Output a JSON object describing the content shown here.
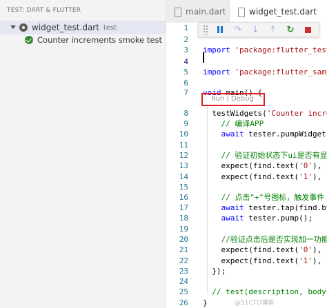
{
  "sidebar": {
    "header": "TEST: DART & FLUTTER",
    "file": {
      "name": "widget_test.dart",
      "desc": "test"
    },
    "test": {
      "name": "Counter increments smoke test"
    }
  },
  "tabs": [
    {
      "label": "main.dart"
    },
    {
      "label": "widget_test.dart"
    }
  ],
  "codelens": "Run | Debug",
  "lines": [
    {
      "n": "1",
      "t": ""
    },
    {
      "n": "2",
      "t": ""
    },
    {
      "n": "3",
      "kw": "import",
      "s": " 'package:flutter_test/"
    },
    {
      "n": "4",
      "t": ""
    },
    {
      "n": "5",
      "kw": "import",
      "s": " 'package:flutter_sampl"
    },
    {
      "n": "6",
      "t": ""
    },
    {
      "n": "7",
      "kw": "void",
      "t": " main() {"
    },
    {
      "n": "8",
      "t": "  testWidgets(",
      "s": "'Counter increm"
    },
    {
      "n": "9",
      "c": "    // 编译APP"
    },
    {
      "n": "10",
      "kw2": "    await",
      "t": " tester.pumpWidget(M"
    },
    {
      "n": "11",
      "t": ""
    },
    {
      "n": "12",
      "c": "    // 验证初始状态下ui是否有显"
    },
    {
      "n": "13",
      "t": "    expect(find.text(",
      "s": "'0'",
      "t2": "), fi"
    },
    {
      "n": "14",
      "t": "    expect(find.text(",
      "s": "'1'",
      "t2": "), fi"
    },
    {
      "n": "15",
      "t": ""
    },
    {
      "n": "16",
      "c": "    // 点击\"+\"号图标，触发事件"
    },
    {
      "n": "17",
      "kw2": "    await",
      "t": " tester.tap(find.byI"
    },
    {
      "n": "18",
      "kw2": "    await",
      "t": " tester.pump();"
    },
    {
      "n": "19",
      "t": ""
    },
    {
      "n": "20",
      "c": "    //验证点击后是否实现加一功能"
    },
    {
      "n": "21",
      "t": "    expect(find.text(",
      "s": "'0'",
      "t2": "), fi"
    },
    {
      "n": "22",
      "t": "    expect(find.text(",
      "s": "'1'",
      "t2": "), fi"
    },
    {
      "n": "23",
      "t": "  });"
    },
    {
      "n": "24",
      "t": ""
    },
    {
      "n": "25",
      "c": "  // test(description, body);"
    },
    {
      "n": "26",
      "t": "}"
    }
  ],
  "line1_fragment": "er",
  "watermark": "@51CTO博客",
  "colors": {
    "accent": "#1a6fc9",
    "pass": "#388a34",
    "stop": "#c72e2e",
    "highlight_box": "#e02020"
  }
}
